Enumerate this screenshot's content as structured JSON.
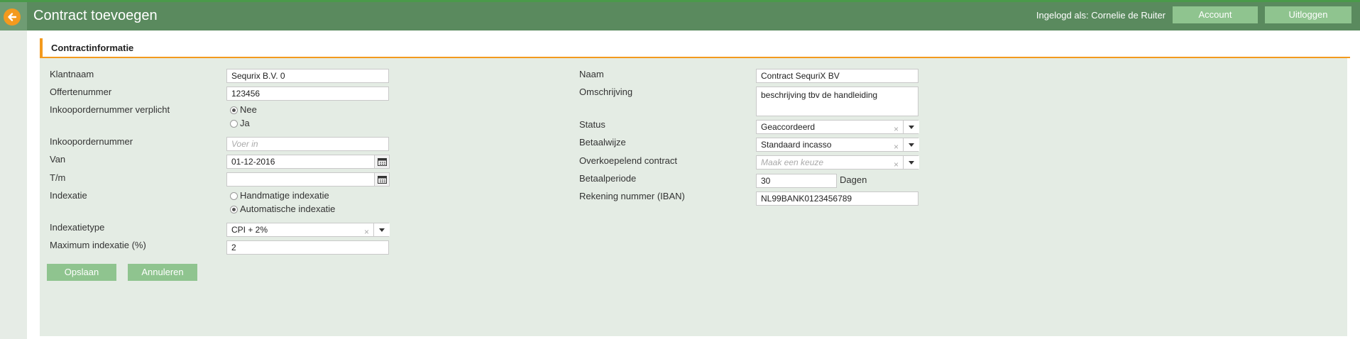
{
  "header": {
    "title": "Contract toevoegen",
    "login_text": "Ingelogd als: Cornelie de Ruiter",
    "account_label": "Account",
    "logout_label": "Uitloggen",
    "back_icon": "arrow-left-icon"
  },
  "section": {
    "title": "Contractinformatie"
  },
  "left": {
    "klantnaam": {
      "label": "Klantnaam",
      "value": "Sequrix B.V. 0"
    },
    "offertenummer": {
      "label": "Offertenummer",
      "value": "123456"
    },
    "inkoop_verplicht": {
      "label": "Inkoopordernummer verplicht",
      "option_nee": "Nee",
      "option_ja": "Ja",
      "selected": "Nee"
    },
    "inkoopordernummer": {
      "label": "Inkoopordernummer",
      "placeholder": "Voer in",
      "value": ""
    },
    "van": {
      "label": "Van",
      "value": "01-12-2016"
    },
    "tm": {
      "label": "T/m",
      "value": ""
    },
    "indexatie": {
      "label": "Indexatie",
      "option_handmatig": "Handmatige indexatie",
      "option_automatisch": "Automatische indexatie",
      "selected": "Automatische indexatie"
    },
    "indexatietype": {
      "label": "Indexatietype",
      "value": "CPI + 2%"
    },
    "max_indexatie": {
      "label": "Maximum indexatie (%)",
      "value": "2"
    }
  },
  "right": {
    "naam": {
      "label": "Naam",
      "value": "Contract SequriX BV"
    },
    "omschrijving": {
      "label": "Omschrijving",
      "value": "beschrijving tbv de handleiding"
    },
    "status": {
      "label": "Status",
      "value": "Geaccordeerd"
    },
    "betaalwijze": {
      "label": "Betaalwijze",
      "value": "Standaard incasso"
    },
    "overkoepelend": {
      "label": "Overkoepelend contract",
      "placeholder": "Maak een keuze"
    },
    "betaalperiode": {
      "label": "Betaalperiode",
      "value": "30",
      "unit": "Dagen"
    },
    "iban": {
      "label": "Rekening nummer (IBAN)",
      "value": "NL99BANK0123456789"
    }
  },
  "actions": {
    "save_label": "Opslaan",
    "cancel_label": "Annuleren"
  },
  "colors": {
    "header": "#5a8a5e",
    "accent": "#f39a1e",
    "button": "#8fc48f",
    "panel": "#e4ece4"
  },
  "icons": {
    "clear": "×",
    "calendar": "calendar-icon",
    "dropdown": "chevron-down-icon"
  }
}
